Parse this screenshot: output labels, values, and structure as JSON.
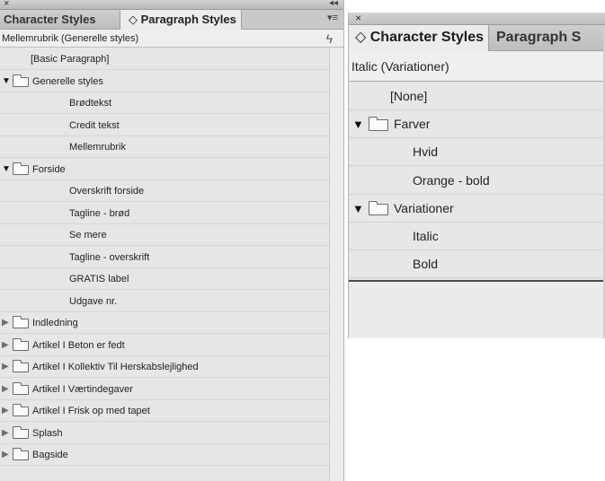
{
  "left_panel": {
    "close_glyph": "×",
    "collapse_glyph": "◂◂",
    "tabs": [
      {
        "label": "Character Styles",
        "active": false
      },
      {
        "label": "◇ Paragraph Styles",
        "active": true
      }
    ],
    "tab_menu_glyph": "▾≡",
    "current_style": "Mellemrubrik (Generelle styles)",
    "bolt_glyph": "ϟ",
    "items": [
      {
        "label": "[Basic Paragraph]",
        "level": 1,
        "type": "style"
      },
      {
        "label": "Generelle styles",
        "level": 0,
        "type": "group",
        "expanded": true
      },
      {
        "label": "Brødtekst",
        "level": 2,
        "type": "style"
      },
      {
        "label": "Credit tekst",
        "level": 2,
        "type": "style"
      },
      {
        "label": "Mellemrubrik",
        "level": 2,
        "type": "style"
      },
      {
        "label": "Forside",
        "level": 0,
        "type": "group",
        "expanded": true
      },
      {
        "label": "Overskrift forside",
        "level": 2,
        "type": "style"
      },
      {
        "label": "Tagline - brød",
        "level": 2,
        "type": "style"
      },
      {
        "label": "Se mere",
        "level": 2,
        "type": "style"
      },
      {
        "label": "Tagline - overskrift",
        "level": 2,
        "type": "style"
      },
      {
        "label": "GRATIS label",
        "level": 2,
        "type": "style"
      },
      {
        "label": "Udgave nr.",
        "level": 2,
        "type": "style"
      },
      {
        "label": "Indledning",
        "level": 0,
        "type": "group",
        "expanded": false
      },
      {
        "label": "Artikel I Beton er fedt",
        "level": 0,
        "type": "group",
        "expanded": false
      },
      {
        "label": "Artikel I Kollektiv Til Herskabslejlighed",
        "level": 0,
        "type": "group",
        "expanded": false
      },
      {
        "label": "Artikel I Værtindegaver",
        "level": 0,
        "type": "group",
        "expanded": false
      },
      {
        "label": "Artikel I Frisk op med tapet",
        "level": 0,
        "type": "group",
        "expanded": false
      },
      {
        "label": "Splash",
        "level": 0,
        "type": "group",
        "expanded": false
      },
      {
        "label": "Bagside",
        "level": 0,
        "type": "group",
        "expanded": false
      }
    ]
  },
  "right_panel": {
    "close_glyph": "×",
    "tabs": [
      {
        "label": "◇ Character Styles",
        "active": true
      },
      {
        "label": "Paragraph S",
        "active": false
      }
    ],
    "current_style": "Italic (Variationer)",
    "items": [
      {
        "label": "[None]",
        "level": 1,
        "type": "style"
      },
      {
        "label": "Farver",
        "level": 0,
        "type": "group",
        "expanded": true
      },
      {
        "label": "Hvid",
        "level": 2,
        "type": "style"
      },
      {
        "label": "Orange - bold",
        "level": 2,
        "type": "style"
      },
      {
        "label": "Variationer",
        "level": 0,
        "type": "group",
        "expanded": true
      },
      {
        "label": "Italic",
        "level": 2,
        "type": "style"
      },
      {
        "label": "Bold",
        "level": 2,
        "type": "style"
      }
    ]
  },
  "glyphs": {
    "expanded": "▼",
    "collapsed": "▶"
  }
}
